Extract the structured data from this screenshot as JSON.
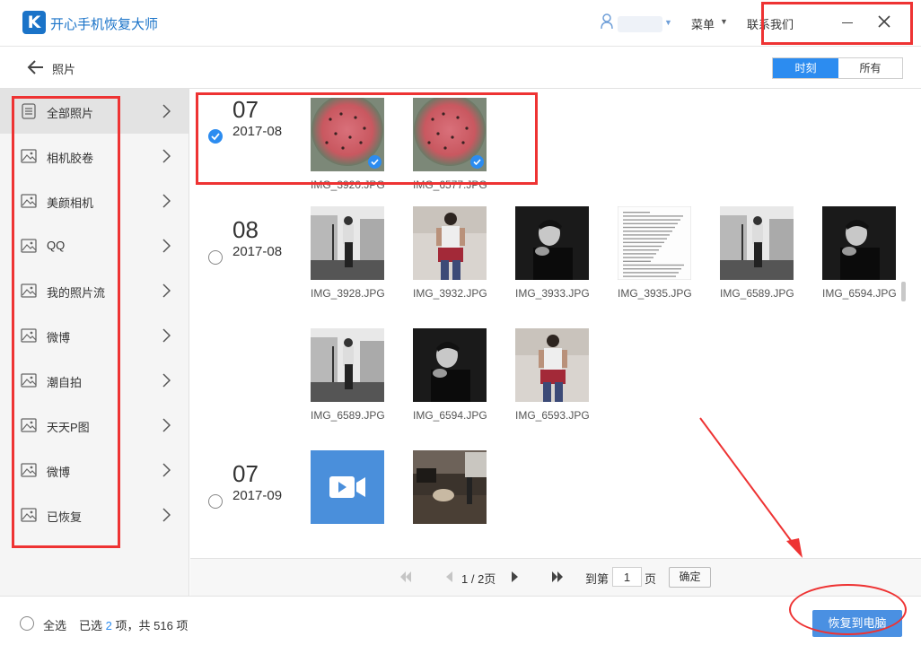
{
  "app": {
    "title": "开心手机恢复大师",
    "logo_letter": "K",
    "menu_label": "菜单",
    "contact_label": "联系我们"
  },
  "subbar": {
    "page_title": "照片",
    "view_toggle": [
      {
        "label": "时刻",
        "active": true
      },
      {
        "label": "所有",
        "active": false
      }
    ]
  },
  "sidebar": {
    "items": [
      {
        "label": "全部照片",
        "icon": "document-icon",
        "active": true
      },
      {
        "label": "相机胶卷",
        "icon": "image-icon",
        "active": false
      },
      {
        "label": "美颜相机",
        "icon": "image-icon",
        "active": false
      },
      {
        "label": "QQ",
        "icon": "image-icon",
        "active": false
      },
      {
        "label": "我的照片流",
        "icon": "image-icon",
        "active": false
      },
      {
        "label": "微博",
        "icon": "image-icon",
        "active": false
      },
      {
        "label": "潮自拍",
        "icon": "image-icon",
        "active": false
      },
      {
        "label": "天天P图",
        "icon": "image-icon",
        "active": false
      },
      {
        "label": "微博",
        "icon": "image-icon",
        "active": false
      },
      {
        "label": "已恢复",
        "icon": "image-icon",
        "active": false
      }
    ]
  },
  "groups": [
    {
      "day": "07",
      "month": "2017-08",
      "checked": true,
      "photos": [
        {
          "name": "IMG_3920.JPG",
          "kind": "watermelon",
          "selected": true
        },
        {
          "name": "IMG_6577.JPG",
          "kind": "watermelon",
          "selected": true
        }
      ]
    },
    {
      "day": "08",
      "month": "2017-08",
      "checked": false,
      "photos": [
        {
          "name": "IMG_3928.JPG",
          "kind": "bw-court",
          "selected": false
        },
        {
          "name": "IMG_3932.JPG",
          "kind": "color-portrait",
          "selected": false
        },
        {
          "name": "IMG_3933.JPG",
          "kind": "bw-dark",
          "selected": false
        },
        {
          "name": "IMG_3935.JPG",
          "kind": "text-doc",
          "selected": false
        },
        {
          "name": "IMG_6589.JPG",
          "kind": "bw-court",
          "selected": false
        },
        {
          "name": "IMG_6594.JPG",
          "kind": "bw-dark",
          "selected": false
        },
        {
          "name": "IMG_6589.JPG",
          "kind": "bw-court",
          "selected": false
        },
        {
          "name": "IMG_6594.JPG",
          "kind": "bw-dark",
          "selected": false
        },
        {
          "name": "IMG_6593.JPG",
          "kind": "color-portrait",
          "selected": false
        }
      ]
    },
    {
      "day": "07",
      "month": "2017-09",
      "checked": false,
      "photos": [
        {
          "name": "",
          "kind": "video",
          "selected": false
        },
        {
          "name": "",
          "kind": "room",
          "selected": false
        }
      ]
    }
  ],
  "pagination": {
    "page_info": "1 / 2页",
    "goto_label": "到第",
    "input_value": "1",
    "page_suffix": "页",
    "confirm_label": "确定"
  },
  "footer": {
    "select_all": "全选",
    "selected_prefix": "已选",
    "selected_count": "2",
    "selected_suffix": "项，共 516 项",
    "recover_label": "恢复到电脑"
  },
  "colors": {
    "accent": "#2c8cf0",
    "brand": "#1a73c8",
    "annotation_red": "#ee3333"
  }
}
